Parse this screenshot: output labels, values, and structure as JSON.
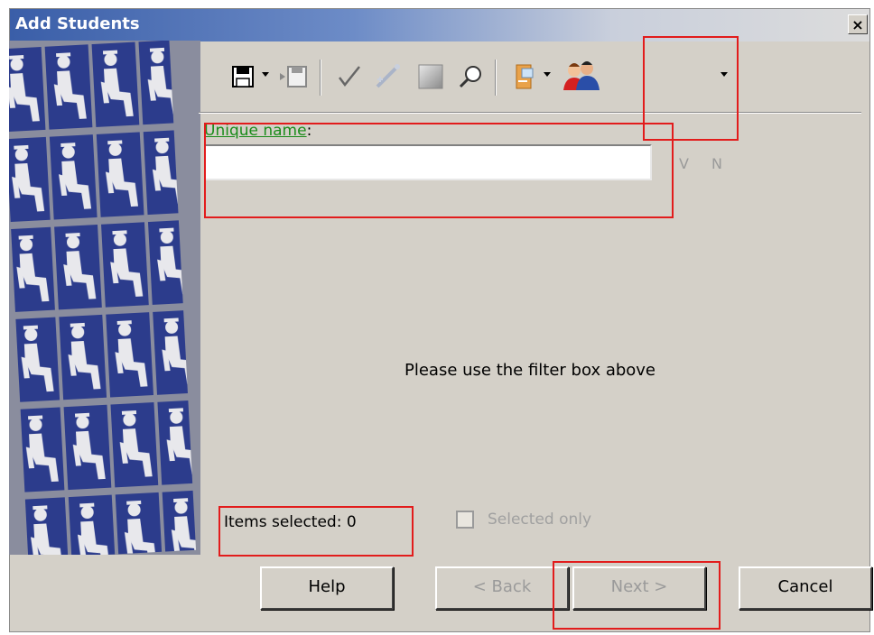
{
  "window": {
    "title": "Add Students",
    "close_label": "×"
  },
  "toolbar": {
    "icons": [
      "save-icon",
      "save-load-icon",
      "check-icon",
      "magic-wand-icon",
      "gradient-icon",
      "search-icon",
      "export-icon",
      "students-icon"
    ]
  },
  "filter": {
    "label": "Unique name",
    "label_suffix": ":",
    "value": "",
    "v_label": "V",
    "n_label": "N"
  },
  "main": {
    "message": "Please use the filter box above"
  },
  "footer": {
    "items_selected": "Items selected: 0",
    "selected_only": "Selected only",
    "buttons": {
      "help": "Help",
      "back": "< Back",
      "next": "Next >",
      "cancel": "Cancel"
    }
  },
  "colors": {
    "highlight": "#e21c1c",
    "link": "#1a8c1a",
    "face": "#d4d0c8"
  }
}
